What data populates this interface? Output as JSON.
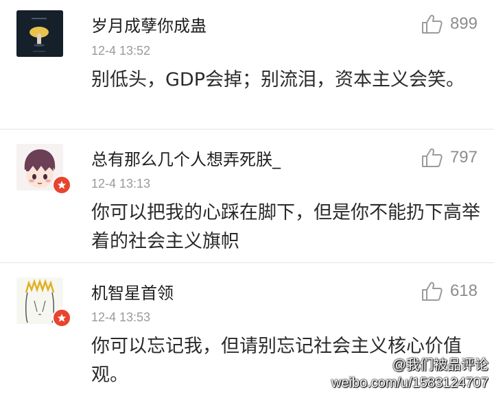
{
  "comments": [
    {
      "username": "岁月成孽你成蛊",
      "time": "12-4 13:52",
      "text": "别低头，GDP会掉；别流泪，资本主义会笑。",
      "likes": "899",
      "avatar": "mushroom-avatar",
      "verified": false
    },
    {
      "username": "总有那么几个人想弄死朕_",
      "time": "12-4 13:13",
      "text": "你可以把我的心踩在脚下，但是你不能扔下高举着的社会主义旗帜",
      "likes": "797",
      "avatar": "anime-boy-avatar",
      "verified": true
    },
    {
      "username": "机智星首领",
      "time": "12-4 13:53",
      "text": "你可以忘记我，但请别忘记社会主义核心价值观。",
      "likes": "618",
      "avatar": "sketch-face-avatar",
      "verified": true
    }
  ],
  "watermark": {
    "account": "@我们被品评论",
    "url": "weibo.com/u/1583124707"
  },
  "colors": {
    "badge": "#e8442e",
    "divider": "#e2e2e2",
    "muted": "#9a9a9a"
  }
}
